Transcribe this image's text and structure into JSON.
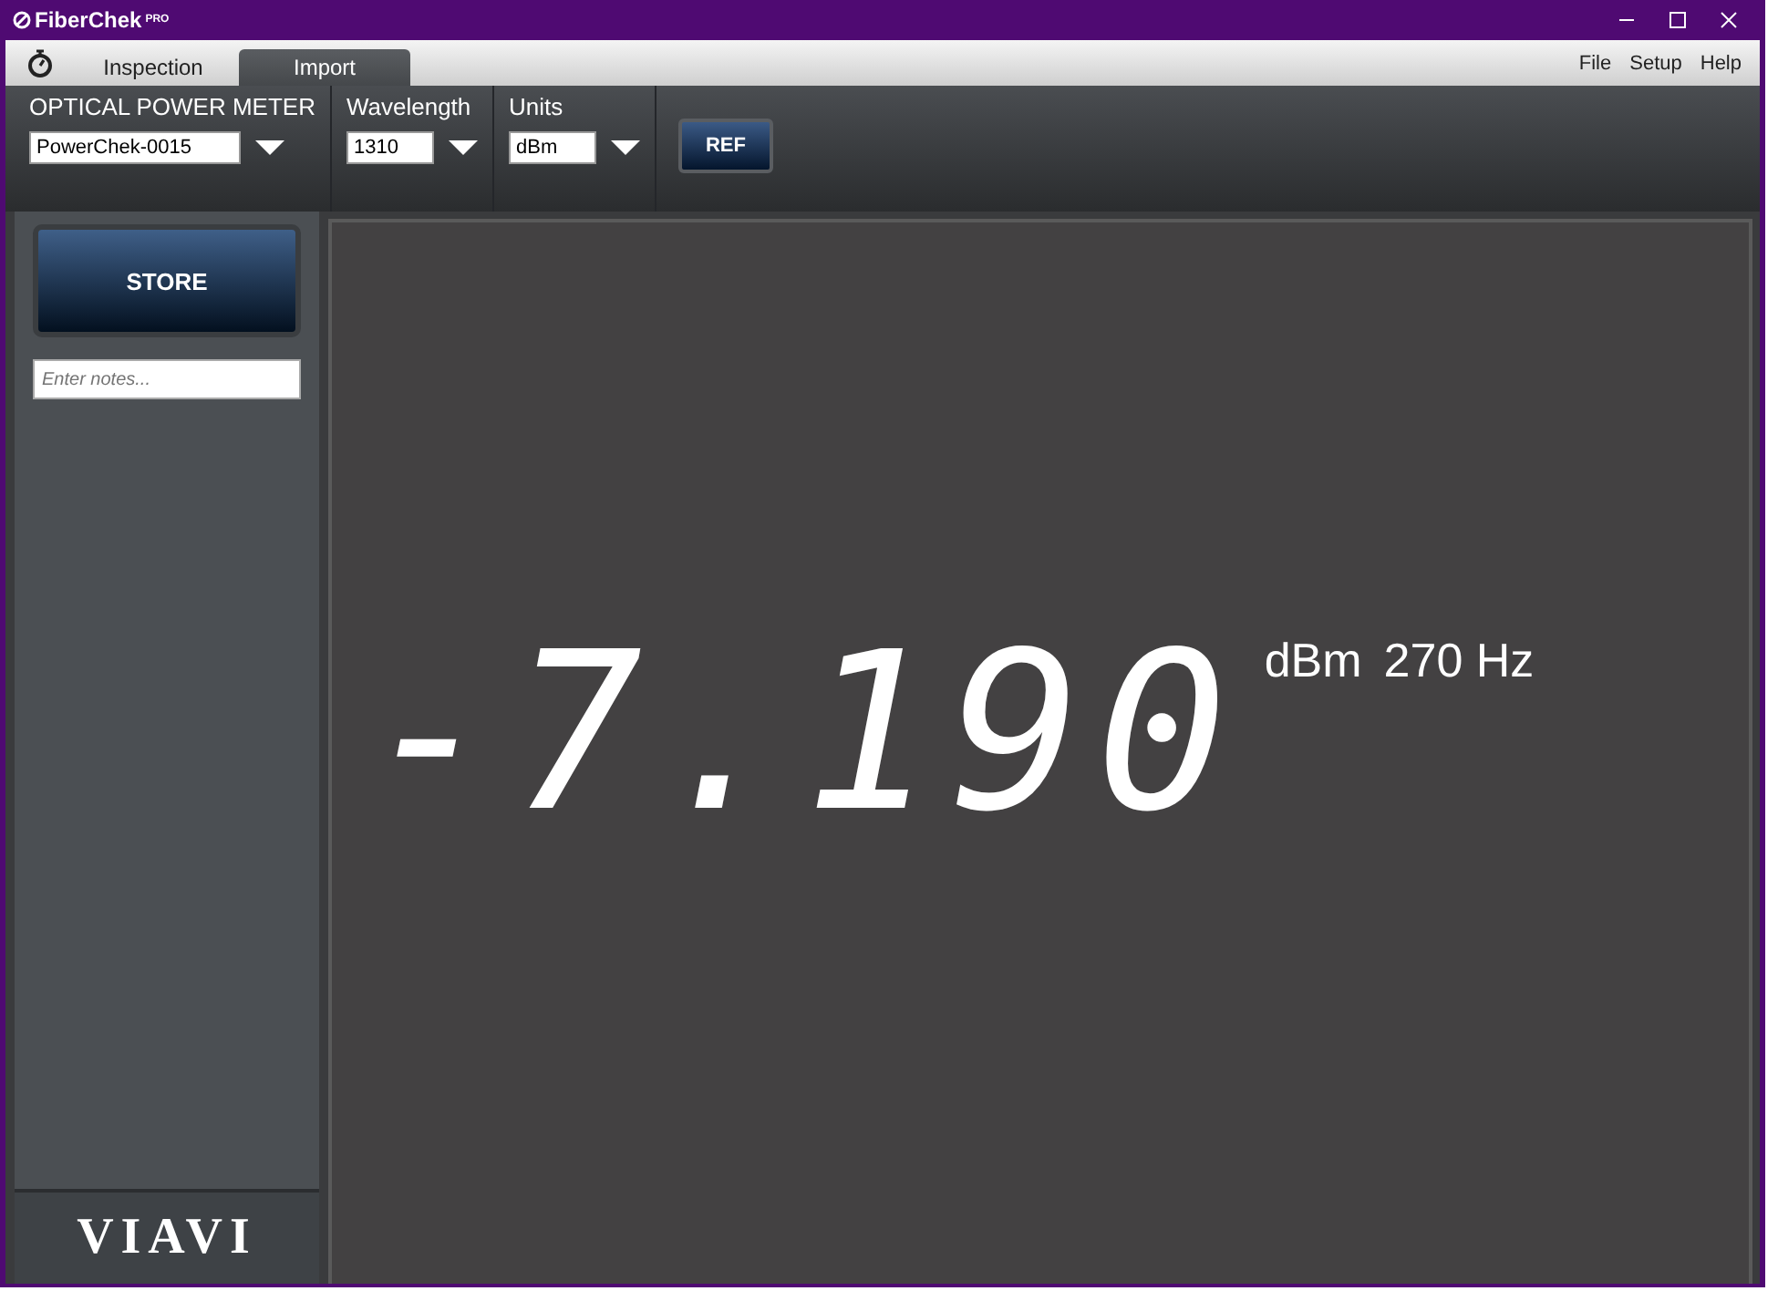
{
  "window": {
    "title": "FiberChek",
    "title_sup": "PRO"
  },
  "tabs": [
    {
      "label": "Inspection",
      "selected": false
    },
    {
      "label": "Import",
      "selected": true
    }
  ],
  "menu": [
    "File",
    "Setup",
    "Help"
  ],
  "toolbar": {
    "meter": {
      "label": "OPTICAL POWER METER",
      "value": "PowerChek-0015"
    },
    "wavelength": {
      "label": "Wavelength",
      "value": "1310"
    },
    "units": {
      "label": "Units",
      "value": "dBm"
    },
    "ref_button": "REF"
  },
  "sidebar": {
    "store_button": "STORE",
    "notes": {
      "placeholder": "Enter notes..."
    },
    "logo": "VIAVI"
  },
  "display": {
    "reading": "-7.190",
    "unit": "dBm",
    "frequency": "270 Hz"
  }
}
